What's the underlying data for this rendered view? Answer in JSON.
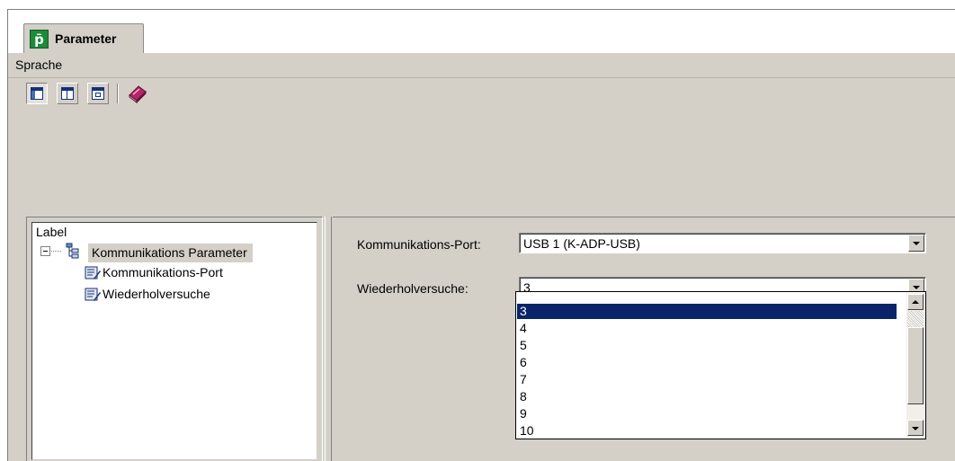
{
  "tab": {
    "title": "Parameter",
    "icon": "pepperl-fuchs-logo-icon"
  },
  "menu": {
    "items": [
      {
        "label": "Sprache"
      }
    ]
  },
  "toolbar": {
    "buttons": [
      {
        "icon": "layout-left-pane-icon"
      },
      {
        "icon": "layout-top-pane-icon"
      },
      {
        "icon": "layout-detail-icon"
      },
      {
        "icon": "book-help-icon"
      }
    ]
  },
  "tree": {
    "header": "Label",
    "root": {
      "label": "Kommunikations Parameter",
      "expanded": true,
      "icon": "network-tree-icon"
    },
    "children": [
      {
        "label": "Kommunikations-Port",
        "icon": "parameter-edit-icon"
      },
      {
        "label": "Wiederholversuche",
        "icon": "parameter-edit-icon"
      }
    ]
  },
  "detail": {
    "port": {
      "label": "Kommunikations-Port:",
      "value": "USB 1 (K-ADP-USB)"
    },
    "retries": {
      "label": "Wiederholversuche:",
      "value": "3",
      "options": [
        "3",
        "4",
        "5",
        "6",
        "7",
        "8",
        "9",
        "10"
      ],
      "highlighted": "3"
    }
  },
  "colors": {
    "selection": "#0a246a",
    "face": "#d4d0c8",
    "logo_green": "#1e8a3c"
  }
}
